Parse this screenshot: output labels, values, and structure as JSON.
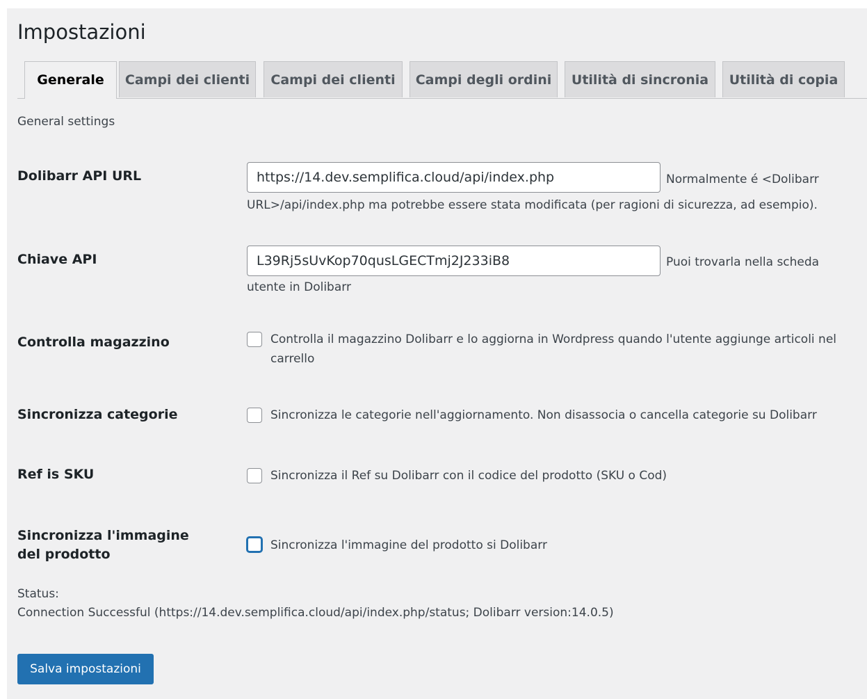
{
  "page": {
    "title": "Impostazioni"
  },
  "tabs": [
    {
      "label": "Generale",
      "active": true
    },
    {
      "label": "Campi dei clienti"
    },
    {
      "label": "Campi dei clienti"
    },
    {
      "label": "Campi degli ordini"
    },
    {
      "label": "Utilità di sincronia"
    },
    {
      "label": "Utilità di copia"
    }
  ],
  "section": {
    "description": "General settings"
  },
  "fields": {
    "api_url": {
      "label": "Dolibarr API URL",
      "value": "https://14.dev.semplifica.cloud/api/index.php",
      "desc_part1": "Normalmente é <Dolibarr",
      "desc_part2": "URL>/api/index.php ma potrebbe essere stata modificata (per ragioni di sicurezza, ad esempio)."
    },
    "api_key": {
      "label": "Chiave API",
      "value": "L39Rj5sUvKop70qusLGECTmj2J233iB8",
      "desc_part1": "Puoi trovarla nella scheda",
      "desc_part2": "utente in Dolibarr"
    },
    "stock": {
      "label": "Controlla magazzino",
      "checked": false,
      "text": "Controlla il magazzino Dolibarr e lo aggiorna in Wordpress quando l'utente aggiunge articoli nel carrello"
    },
    "categories": {
      "label": "Sincronizza categorie",
      "checked": false,
      "text": "Sincronizza le categorie nell'aggiornamento. Non disassocia o cancella categorie su Dolibarr"
    },
    "ref_sku": {
      "label": "Ref is SKU",
      "checked": false,
      "text": "Sincronizza il Ref su Dolibarr con il codice del prodotto (SKU o Cod)"
    },
    "image": {
      "label": "Sincronizza l'immagine del prodotto",
      "checked": false,
      "text": "Sincronizza l'immagine del prodotto si Dolibarr"
    }
  },
  "status": {
    "label": "Status:",
    "message": "Connection Successful (https://14.dev.semplifica.cloud/api/index.php/status; Dolibarr version:14.0.5)"
  },
  "actions": {
    "save_label": "Salva impostazioni"
  },
  "colors": {
    "primary": "#2271b1",
    "background": "#f0f0f1",
    "tab_inactive": "#dcdcde"
  }
}
